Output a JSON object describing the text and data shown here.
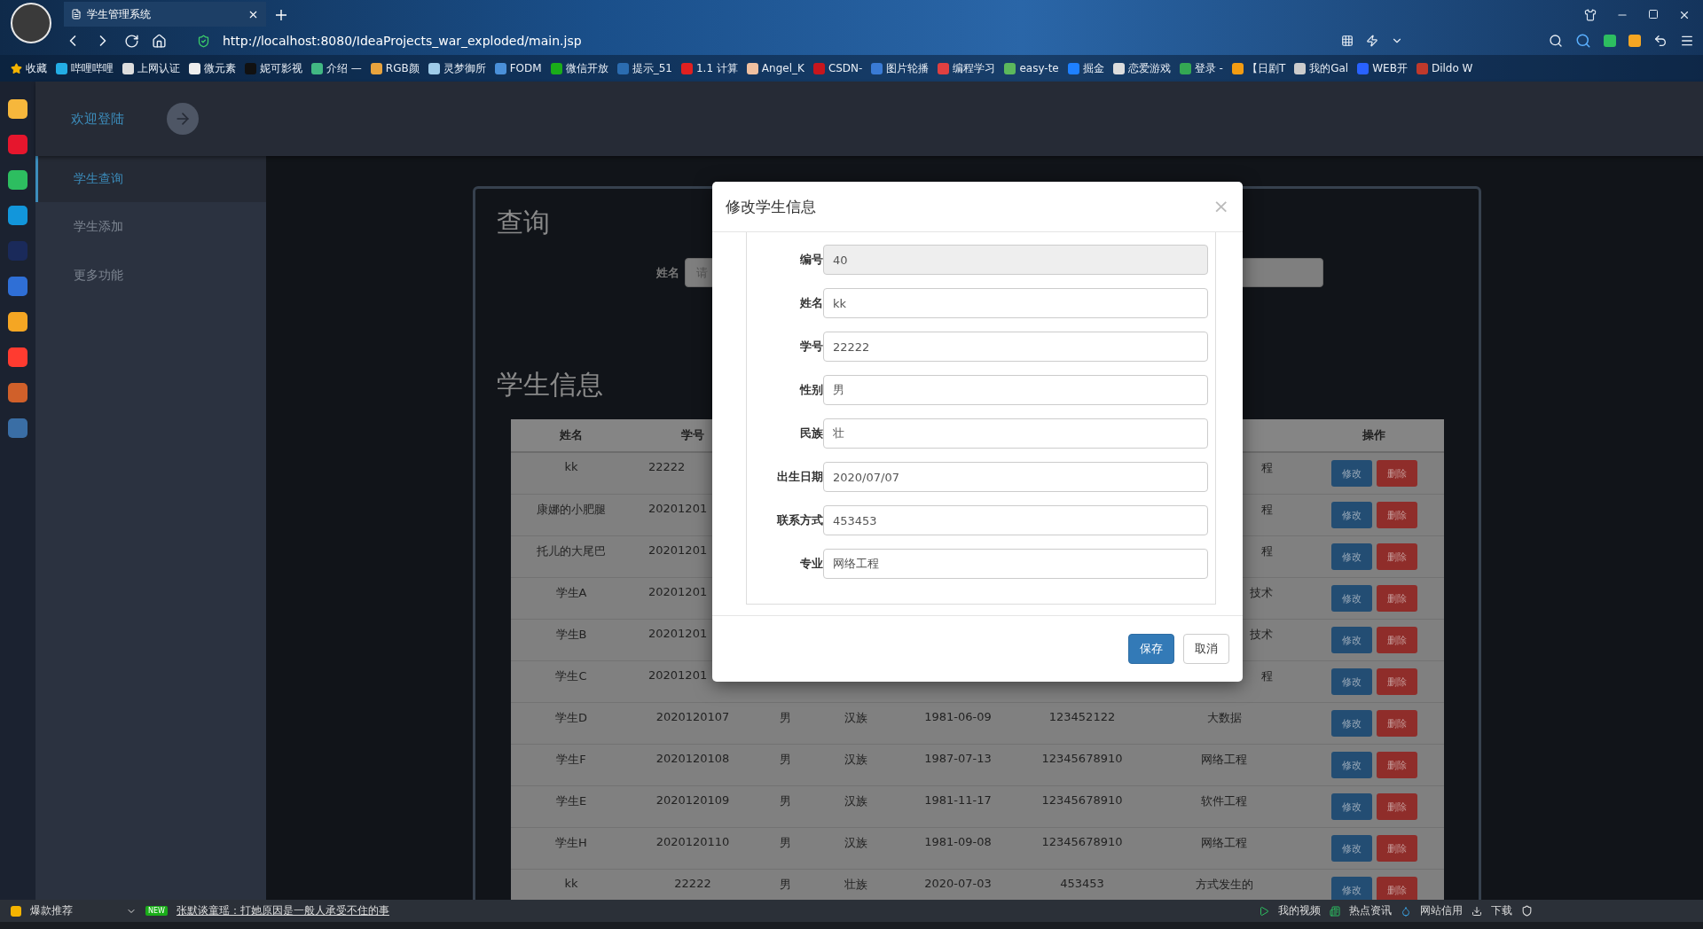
{
  "browser": {
    "tab": {
      "title": "学生管理系统",
      "selected": true
    },
    "url": "http://localhost:8080/IdeaProjects_war_exploded/main.jsp",
    "bookmarks": [
      {
        "label": "收藏",
        "color": "#f5b400"
      },
      {
        "label": "哔哩哔哩",
        "color": "#23ade5"
      },
      {
        "label": "上网认证",
        "color": "#dddddd"
      },
      {
        "label": "微元素",
        "color": "#eeeeee"
      },
      {
        "label": "妮可影视",
        "color": "#111111"
      },
      {
        "label": "介绍 —",
        "color": "#41b883"
      },
      {
        "label": "RGB颜",
        "color": "#e8a33d"
      },
      {
        "label": "灵梦御所",
        "color": "#9ecbe8"
      },
      {
        "label": "FODM",
        "color": "#4a90d9"
      },
      {
        "label": "微信开放",
        "color": "#1aad19"
      },
      {
        "label": "提示_51",
        "color": "#2b6cb0"
      },
      {
        "label": "1.1 计算",
        "color": "#e02020"
      },
      {
        "label": "Angel_K",
        "color": "#f0c0a0"
      },
      {
        "label": "CSDN-",
        "color": "#c8161d"
      },
      {
        "label": "图片轮播",
        "color": "#3a7bd5"
      },
      {
        "label": "编程学习",
        "color": "#e04040"
      },
      {
        "label": "easy-te",
        "color": "#5cb85c"
      },
      {
        "label": "掘金",
        "color": "#1e80ff"
      },
      {
        "label": "恋爱游戏",
        "color": "#dddddd"
      },
      {
        "label": "登录 -",
        "color": "#34a853"
      },
      {
        "label": "【日剧T",
        "color": "#f39c12"
      },
      {
        "label": "我的Gal",
        "color": "#cccccc"
      },
      {
        "label": "WEB开",
        "color": "#2962ff"
      },
      {
        "label": "Dildo W",
        "color": "#c0392b"
      }
    ],
    "side_apps": [
      {
        "color": "#f6b73c"
      },
      {
        "color": "#e6162d"
      },
      {
        "color": "#2dbe60"
      },
      {
        "color": "#1296db"
      },
      {
        "color": "#1a2a5a"
      },
      {
        "color": "#2f6fd6"
      },
      {
        "color": "#f5a623"
      },
      {
        "color": "#ff3b30"
      },
      {
        "color": "#d0602a"
      },
      {
        "color": "#3a6ea5"
      }
    ]
  },
  "header": {
    "welcome": "欢迎登陆"
  },
  "sidebar": {
    "items": [
      {
        "label": "学生查询",
        "selected": true
      },
      {
        "label": "学生添加",
        "selected": false
      },
      {
        "label": "更多功能",
        "selected": false
      }
    ]
  },
  "query": {
    "title": "查询",
    "field_label": "姓名",
    "placeholder": "请"
  },
  "students": {
    "title": "学生信息",
    "header": {
      "name": "姓名",
      "number": "学号",
      "actions": "操作"
    },
    "rows": [
      {
        "name": "kk",
        "number": "22222",
        "major": "程",
        "edit": "修改",
        "delete": "删除"
      },
      {
        "name": "康娜的小肥腿",
        "number": "20201201",
        "major": "程",
        "edit": "修改",
        "delete": "删除"
      },
      {
        "name": "托儿的大尾巴",
        "number": "20201201",
        "major": "程",
        "edit": "修改",
        "delete": "删除"
      },
      {
        "name": "学生A",
        "number": "20201201",
        "major": "技术",
        "edit": "修改",
        "delete": "删除"
      },
      {
        "name": "学生B",
        "number": "20201201",
        "major": "技术",
        "edit": "修改",
        "delete": "删除"
      },
      {
        "name": "学生C",
        "number": "20201201",
        "major": "程",
        "edit": "修改",
        "delete": "删除"
      },
      {
        "name": "学生D",
        "number": "2020120107",
        "gender": "男",
        "ethnicity": "汉族",
        "birth": "1981-06-09",
        "contact": "123452122",
        "major": "大数据",
        "edit": "修改",
        "delete": "删除"
      },
      {
        "name": "学生F",
        "number": "2020120108",
        "gender": "男",
        "ethnicity": "汉族",
        "birth": "1987-07-13",
        "contact": "12345678910",
        "major": "网络工程",
        "edit": "修改",
        "delete": "删除"
      },
      {
        "name": "学生E",
        "number": "2020120109",
        "gender": "男",
        "ethnicity": "汉族",
        "birth": "1981-11-17",
        "contact": "12345678910",
        "major": "软件工程",
        "edit": "修改",
        "delete": "删除"
      },
      {
        "name": "学生H",
        "number": "2020120110",
        "gender": "男",
        "ethnicity": "汉族",
        "birth": "1981-09-08",
        "contact": "12345678910",
        "major": "网络工程",
        "edit": "修改",
        "delete": "删除"
      },
      {
        "name": "kk",
        "number": "22222",
        "gender": "男",
        "ethnicity": "壮族",
        "birth": "2020-07-03",
        "contact": "453453",
        "major": "方式发生的",
        "edit": "修改",
        "delete": "删除"
      }
    ]
  },
  "modal": {
    "title": "修改学生信息",
    "close": "×",
    "fields": [
      {
        "label": "编号",
        "value": "40",
        "disabled": true
      },
      {
        "label": "姓名",
        "value": "kk",
        "disabled": false
      },
      {
        "label": "学号",
        "value": "22222",
        "disabled": false
      },
      {
        "label": "性别",
        "value": "男",
        "disabled": false
      },
      {
        "label": "民族",
        "value": "壮",
        "disabled": false
      },
      {
        "label": "出生日期",
        "value": "2020/07/07",
        "disabled": false
      },
      {
        "label": "联系方式",
        "value": "453453",
        "disabled": false
      },
      {
        "label": "专业",
        "value": "网络工程",
        "disabled": false
      }
    ],
    "save": "保存",
    "cancel": "取消"
  },
  "status_bar": {
    "left_label": "爆款推荐",
    "badge": "NEW",
    "headline": "张默谈童瑶：打她原因是一般人承受不住的事",
    "right_items": [
      "我的视频",
      "热点资讯",
      "网站信用",
      "下载"
    ]
  }
}
